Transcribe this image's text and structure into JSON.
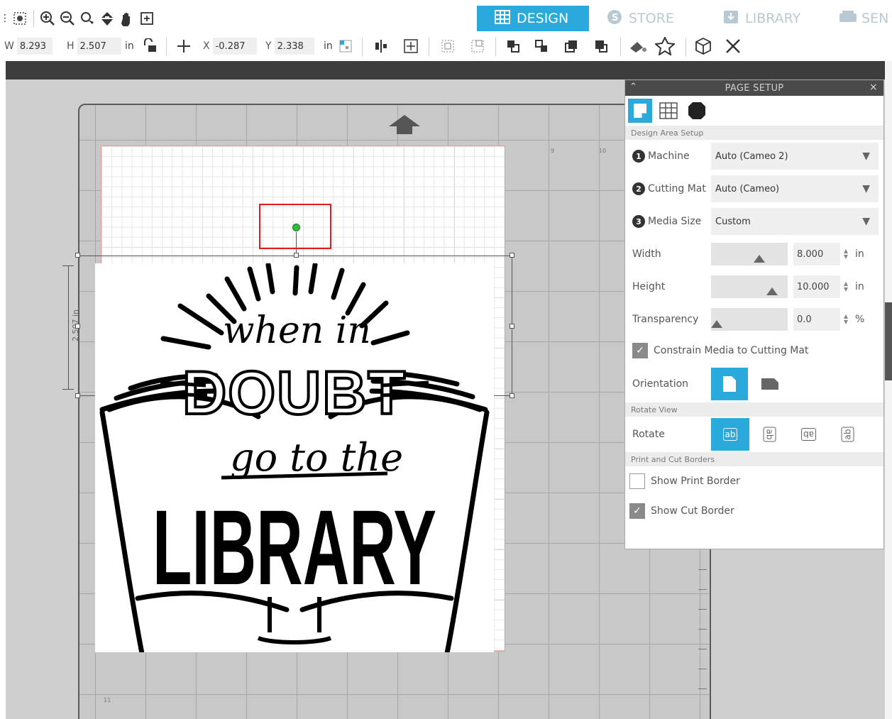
{
  "toolbar": {
    "tools": [
      "select-tool",
      "zoom-in",
      "zoom-out",
      "zoom-fit",
      "pan-down",
      "hand",
      "fit-page"
    ]
  },
  "tabs": [
    {
      "label": "DESIGN",
      "icon": "grid-icon",
      "active": true
    },
    {
      "label": "STORE",
      "icon": "store-icon",
      "active": false
    },
    {
      "label": "LIBRARY",
      "icon": "library-icon",
      "active": false
    },
    {
      "label": "SEN",
      "icon": "send-icon",
      "active": false
    }
  ],
  "properties": {
    "w_label": "W",
    "w_value": "8.293",
    "h_label": "H",
    "h_value": "2.507",
    "unit1": "in",
    "x_label": "X",
    "x_value": "-0.287",
    "y_label": "Y",
    "y_value": "2.338",
    "unit2": "in"
  },
  "canvas": {
    "dimension_label": "2.507 in",
    "ruler_nums": [
      "9",
      "10"
    ],
    "mat_bottom_num": "11"
  },
  "artwork": {
    "line1": "when in",
    "line2": "DOUBT",
    "line3": "go to the",
    "line4": "LIBRARY"
  },
  "panel": {
    "title": "PAGE SETUP",
    "section_design": "Design Area Setup",
    "machine_label": "Machine",
    "machine_value": "Auto (Cameo 2)",
    "mat_label": "Cutting Mat",
    "mat_value": "Auto (Cameo)",
    "media_label": "Media Size",
    "media_value": "Custom",
    "width_label": "Width",
    "width_value": "8.000",
    "width_unit": "in",
    "height_label": "Height",
    "height_value": "10.000",
    "height_unit": "in",
    "transparency_label": "Transparency",
    "transparency_value": "0.0",
    "transparency_unit": "%",
    "constrain_label": "Constrain Media to Cutting Mat",
    "constrain_checked": true,
    "orientation_label": "Orientation",
    "section_rotate": "Rotate View",
    "rotate_label": "Rotate",
    "section_borders": "Print and Cut Borders",
    "print_border_label": "Show Print Border",
    "print_border_checked": false,
    "cut_border_label": "Show Cut Border",
    "cut_border_checked": true
  },
  "colors": {
    "accent": "#29a9dc",
    "highlight": "#e3191c",
    "rotation_handle": "#27c43b"
  }
}
